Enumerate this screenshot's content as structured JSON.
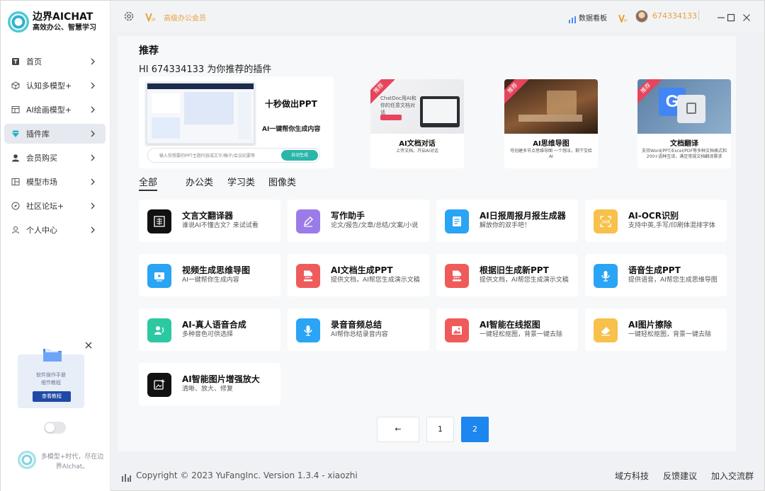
{
  "brand": {
    "name": "边界AICHAT",
    "slogan": "高效办公、智慧学习"
  },
  "topbar": {
    "vip_label": "高级办公会员",
    "board_label": "数据看板",
    "user_id": "674334133"
  },
  "sidebar": {
    "items": [
      {
        "label": "首页",
        "icon": "home-icon"
      },
      {
        "label": "认知多模型+",
        "icon": "cube-icon"
      },
      {
        "label": "AI绘画模型+",
        "icon": "image-icon"
      },
      {
        "label": "插件库",
        "icon": "diamond-icon",
        "active": true
      },
      {
        "label": "会员购买",
        "icon": "user-icon"
      },
      {
        "label": "模型市场",
        "icon": "grid-icon"
      },
      {
        "label": "社区论坛+",
        "icon": "compass-icon"
      },
      {
        "label": "个人中心",
        "icon": "person-icon"
      }
    ],
    "promo": {
      "line1": "软件操作手册",
      "line2": "细节教程",
      "button": "查看教程"
    },
    "footer_text": "多模型+时代，尽在边界AIchat。"
  },
  "main": {
    "title": "推荐",
    "subtitle": "HI 674334133 为你推荐的插件",
    "hero": {
      "headline": "十秒做出PPT",
      "tagline": "AI一键帮你生成内容",
      "input_placeholder": "输入你想要的PPT主题内容或文字/稿子/会议纪要等",
      "button": "自动生成"
    },
    "features": [
      {
        "ribbon": "推荐",
        "title": "AI文档对话",
        "desc": "上传文档，开启AI对话",
        "img_text": "ChatDoc用AI和你的任意文档对话"
      },
      {
        "ribbon": "推荐",
        "title": "AI思维导图",
        "desc": "可创建多节点思维导图 一个想法，剩下交给AI"
      },
      {
        "ribbon": "推荐",
        "title": "文档翻译",
        "desc": "支持Word/PPT/Excel/PDF等多种文档格式和200+语种互译，满足常规文档翻译需求"
      }
    ],
    "tabs": [
      "全部",
      "办公类",
      "学习类",
      "图像类"
    ],
    "cards": [
      {
        "title": "文言文翻译器",
        "desc": "谁说AI不懂古文？来试试看",
        "color": "#111111",
        "icon": "classical-text-icon"
      },
      {
        "title": "写作助手",
        "desc": "论文/报告/文章/总结/文案/小说",
        "color": "#9b7be8",
        "icon": "pen-icon"
      },
      {
        "title": "AI日报周报月报生成器",
        "desc": "解放你的双手吧！",
        "color": "#2aa4f4",
        "icon": "report-icon"
      },
      {
        "title": "AI-OCR识别",
        "desc": "支持中英,手写/印刷体混排字体",
        "color": "#f7c14b",
        "icon": "ocr-icon"
      },
      {
        "title": "视频生成思维导图",
        "desc": "AI一键帮你生成内容",
        "color": "#2aa4f4",
        "icon": "video-icon"
      },
      {
        "title": "AI文档生成PPT",
        "desc": "提供文档，AI帮您生成演示文稿",
        "color": "#ef5b5b",
        "icon": "ppt-icon"
      },
      {
        "title": "根据旧生成新PPT",
        "desc": "提供文档，AI帮您生成演示文稿",
        "color": "#ef5b5b",
        "icon": "ppt-icon"
      },
      {
        "title": "语音生成PPT",
        "desc": "提供语音，AI帮您生成思维导图",
        "color": "#2aa4f4",
        "icon": "microphone-icon"
      },
      {
        "title": "AI-真人语音合成",
        "desc": "多种音色可供选择",
        "color": "#2cc9a0",
        "icon": "voice-icon"
      },
      {
        "title": "录音音频总结",
        "desc": "AI帮你总结录音内容",
        "color": "#2aa4f4",
        "icon": "microphone-icon"
      },
      {
        "title": "AI智能在线抠图",
        "desc": "一键轻松抠图，背景一键去除",
        "color": "#ef5b5b",
        "icon": "picture-icon"
      },
      {
        "title": "AI图片擦除",
        "desc": "一键轻松抠图，背景一键去除",
        "color": "#f7c14b",
        "icon": "eraser-icon"
      },
      {
        "title": "AI智能图片增强放大",
        "desc": "清晰、放大、修复",
        "color": "#111111",
        "icon": "enhance-icon"
      }
    ],
    "pagination": {
      "prev": "←",
      "pages": [
        "1",
        "2"
      ],
      "current": "2"
    }
  },
  "footer": {
    "copyright": "Copyright © 2023 YuFangInc. Version 1.3.4 - xiaozhi",
    "links": [
      "域方科技",
      "反馈建议",
      "加入交流群"
    ]
  },
  "colors": {
    "accent": "#1d86f0",
    "vip": "#e6a23c",
    "ribbon": "#e6455c"
  }
}
